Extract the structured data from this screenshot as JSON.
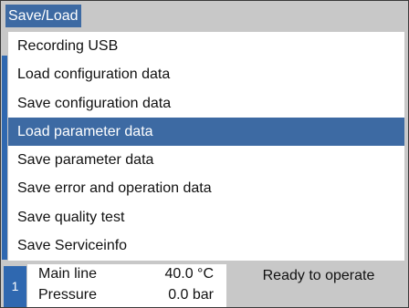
{
  "window": {
    "title": "Save/Load"
  },
  "menu": {
    "items": [
      {
        "label": "Recording USB"
      },
      {
        "label": "Load configuration data"
      },
      {
        "label": "Save configuration data"
      },
      {
        "label": "Load parameter data"
      },
      {
        "label": "Save parameter data"
      },
      {
        "label": "Save error and operation data"
      },
      {
        "label": "Save quality test"
      },
      {
        "label": "Save Serviceinfo"
      }
    ],
    "selected_label": "Load parameter data"
  },
  "status": {
    "channel_number": "1",
    "main_line_label": "Main line",
    "temperature": "40.0 °C",
    "pressure_label": "Pressure",
    "pressure": "0.0 bar",
    "state": "Ready to operate"
  },
  "colors": {
    "accent": "#3d6aa3",
    "panel_gray": "#c8c8c8"
  }
}
